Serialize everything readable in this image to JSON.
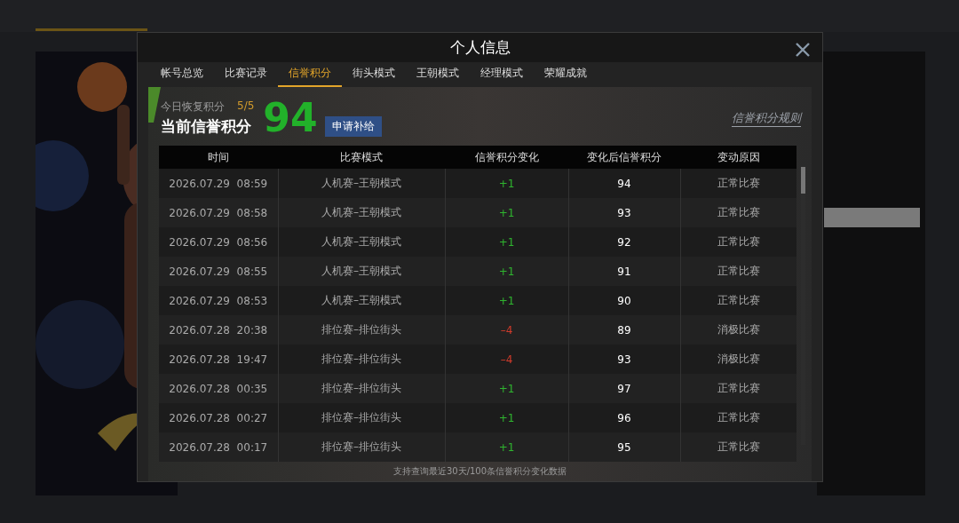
{
  "dialog": {
    "title": "个人信息"
  },
  "tabs": [
    {
      "label": "帐号总览",
      "selected": false
    },
    {
      "label": "比赛记录",
      "selected": false
    },
    {
      "label": "信誉积分",
      "selected": true
    },
    {
      "label": "街头模式",
      "selected": false
    },
    {
      "label": "王朝模式",
      "selected": false
    },
    {
      "label": "经理模式",
      "selected": false
    },
    {
      "label": "荣耀成就",
      "selected": false
    }
  ],
  "summary": {
    "recover_label": "今日恢复积分",
    "recover_value": "5/5",
    "current_label": "当前信誉积分",
    "current_value": "94",
    "apply_button": "申请补给",
    "rules_link": "信誉积分规则"
  },
  "table": {
    "columns": [
      "时间",
      "比赛模式",
      "信誉积分变化",
      "变化后信誉积分",
      "变动原因"
    ],
    "rows": [
      {
        "time": "2026.07.29  08:59",
        "mode": "人机赛–王朝模式",
        "change": "+1",
        "color": "#2fb52f",
        "after": "94",
        "reason": "正常比赛"
      },
      {
        "time": "2026.07.29  08:58",
        "mode": "人机赛–王朝模式",
        "change": "+1",
        "color": "#2fb52f",
        "after": "93",
        "reason": "正常比赛"
      },
      {
        "time": "2026.07.29  08:56",
        "mode": "人机赛–王朝模式",
        "change": "+1",
        "color": "#2fb52f",
        "after": "92",
        "reason": "正常比赛"
      },
      {
        "time": "2026.07.29  08:55",
        "mode": "人机赛–王朝模式",
        "change": "+1",
        "color": "#2fb52f",
        "after": "91",
        "reason": "正常比赛"
      },
      {
        "time": "2026.07.29  08:53",
        "mode": "人机赛–王朝模式",
        "change": "+1",
        "color": "#2fb52f",
        "after": "90",
        "reason": "正常比赛"
      },
      {
        "time": "2026.07.28  20:38",
        "mode": "排位赛–排位街头",
        "change": "–4",
        "color": "#d23b2b",
        "after": "89",
        "reason": "消极比赛"
      },
      {
        "time": "2026.07.28  19:47",
        "mode": "排位赛–排位街头",
        "change": "–4",
        "color": "#d23b2b",
        "after": "93",
        "reason": "消极比赛"
      },
      {
        "time": "2026.07.28  00:35",
        "mode": "排位赛–排位街头",
        "change": "+1",
        "color": "#2fb52f",
        "after": "97",
        "reason": "正常比赛"
      },
      {
        "time": "2026.07.28  00:27",
        "mode": "排位赛–排位街头",
        "change": "+1",
        "color": "#2fb52f",
        "after": "96",
        "reason": "正常比赛"
      },
      {
        "time": "2026.07.28  00:17",
        "mode": "排位赛–排位街头",
        "change": "+1",
        "color": "#2fb52f",
        "after": "95",
        "reason": "正常比赛"
      }
    ],
    "footer": "支持查询最近30天/100条信誉积分变化数据"
  }
}
